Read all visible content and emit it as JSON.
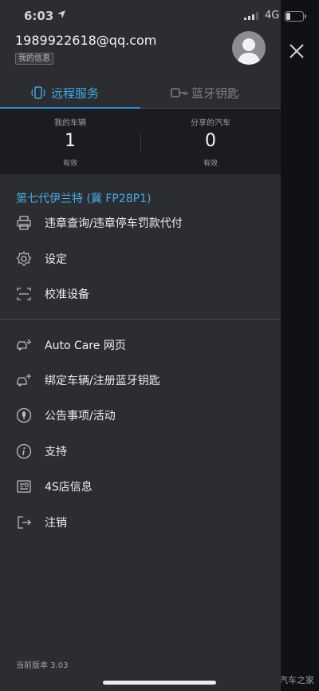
{
  "status_bar": {
    "time": "6:03",
    "network": "4G"
  },
  "header": {
    "email": "1989922618@qq.com",
    "my_info": "我的信息"
  },
  "tabs": [
    {
      "label": "远程服务",
      "active": true,
      "icon": "phone-signal-icon"
    },
    {
      "label": "蓝牙钥匙",
      "active": false,
      "icon": "bluetooth-key-icon"
    }
  ],
  "stats": {
    "my_vehicles": {
      "caption": "我的车辆",
      "value": "1",
      "sub": "有效"
    },
    "shared_cars": {
      "caption": "分享的汽车",
      "value": "0",
      "sub": "有效"
    }
  },
  "vehicle": {
    "title": "第七代伊兰特 (冀 FP28P1)"
  },
  "menu_vehicle": [
    {
      "label": "违章查询/违章停车罚款代付",
      "icon": "printer-icon"
    },
    {
      "label": "设定",
      "icon": "gear-icon"
    },
    {
      "label": "校准设备",
      "icon": "scan-icon"
    }
  ],
  "menu_general": [
    {
      "label": "Auto Care 网页",
      "icon": "car-service-icon"
    },
    {
      "label": "绑定车辆/注册蓝牙钥匙",
      "icon": "add-car-icon"
    },
    {
      "label": "公告事项/活动",
      "icon": "microphone-icon"
    },
    {
      "label": "支持",
      "icon": "info-icon"
    },
    {
      "label": "4S店信息",
      "icon": "dealer-card-icon"
    },
    {
      "label": "注销",
      "icon": "logout-icon"
    }
  ],
  "footer": {
    "version": "当前版本 3.03"
  },
  "watermark": "汽车之家",
  "colors": {
    "accent": "#47abe6",
    "drawer_bg": "#2b2d31",
    "stats_bg": "#1b1c1f"
  }
}
